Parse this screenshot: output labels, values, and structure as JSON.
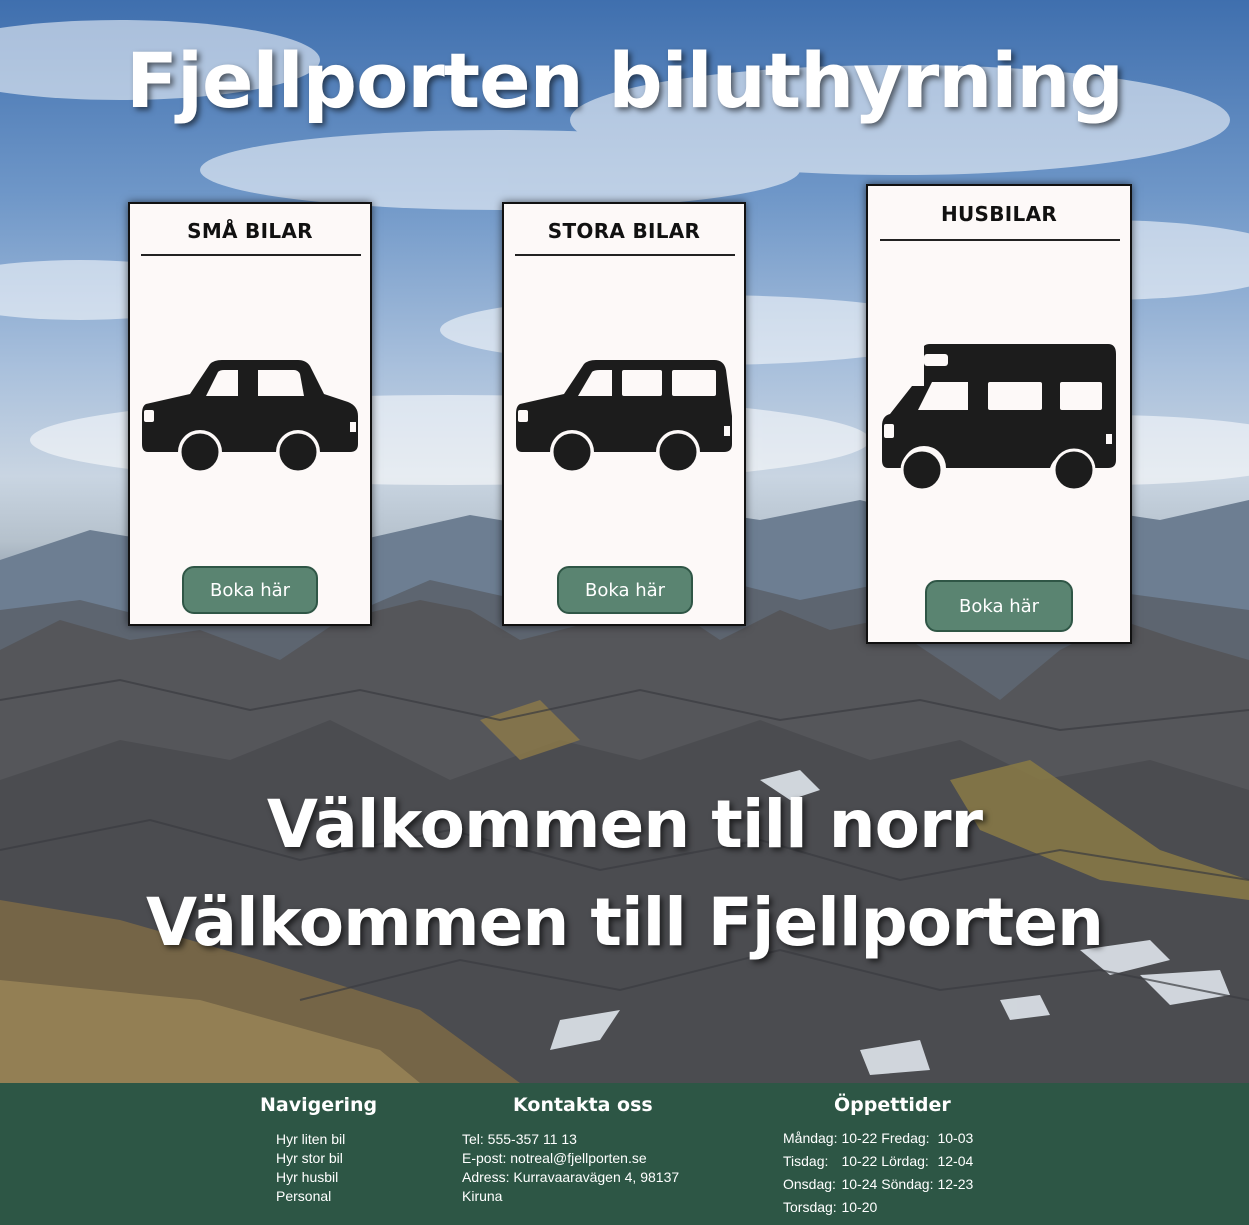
{
  "header": {
    "title": "Fjellporten biluthyrning"
  },
  "cards": [
    {
      "heading": "SMÅ BILAR",
      "icon": "small-car-icon",
      "button": "Boka här"
    },
    {
      "heading": "STORA BILAR",
      "icon": "large-car-icon",
      "button": "Boka här"
    },
    {
      "heading": "HUSBILAR",
      "icon": "motorhome-icon",
      "button": "Boka här"
    }
  ],
  "welcome": {
    "line1": "Välkommen till norr",
    "line2": "Välkommen till Fjellporten"
  },
  "footer": {
    "nav": {
      "heading": "Navigering",
      "items": [
        "Hyr liten bil",
        "Hyr stor bil",
        "Hyr husbil",
        "Personal"
      ]
    },
    "contact": {
      "heading": "Kontakta oss",
      "phone": "Tel: 555-357 11 13",
      "email": "E-post: notreal@fjellporten.se",
      "address_line1": "Adress: Kurravaaravägen 4, 98137",
      "address_line2": "Kiruna"
    },
    "hours": {
      "heading": "Öppettider",
      "rows": [
        {
          "day": "Måndag:",
          "time": "10-22",
          "day2": "Fredag:",
          "time2": "10-03"
        },
        {
          "day": "Tisdag:",
          "time": "10-22",
          "day2": "Lördag:",
          "time2": "12-04"
        },
        {
          "day": "Onsdag:",
          "time": "10-24",
          "day2": "Söndag:",
          "time2": "12-23"
        },
        {
          "day": "Torsdag:",
          "time": "10-20",
          "day2": "",
          "time2": ""
        }
      ]
    }
  },
  "colors": {
    "accent": "#5a8471",
    "footer_bg": "#2d5645",
    "card_bg": "#fdf9f8"
  }
}
